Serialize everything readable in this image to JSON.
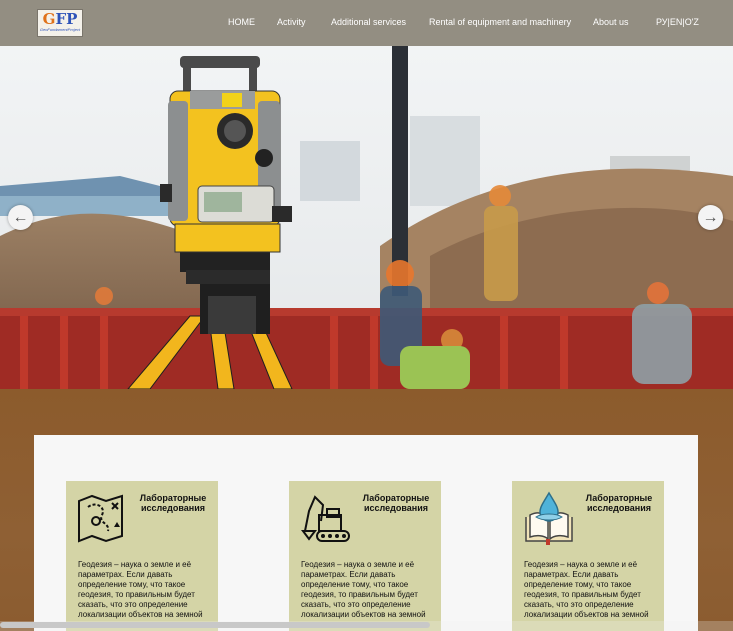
{
  "brand": {
    "logo_text": "GFP",
    "logo_subtext": "GeoFundamentProject"
  },
  "nav": {
    "items": [
      {
        "label": "HOME"
      },
      {
        "label": "Activity"
      },
      {
        "label": "Additional services"
      },
      {
        "label": "Rental of equipment and machinery"
      },
      {
        "label": "About us"
      }
    ],
    "lang": "РУ|EN|O'Z"
  },
  "hero": {
    "prev_icon": "arrow-left-icon",
    "next_icon": "arrow-right-icon"
  },
  "cards": [
    {
      "icon": "map-icon",
      "title": "Лабораторные исследования",
      "text": "Геодезия – наука о земле и её параметрах. Если давать определение тому, что такое геодезия, то правильным будет сказать, что это определение локализации объектов на земной"
    },
    {
      "icon": "excavator-icon",
      "title": "Лабораторные исследования",
      "text": "Геодезия – наука о земле и её параметрах. Если давать определение тому, что такое геодезия, то правильным будет сказать, что это определение локализации объектов на земной"
    },
    {
      "icon": "water-drop-book-icon",
      "title": "Лабораторные исследования",
      "text": "Геодезия – наука о земле и её параметрах. Если давать определение тому, что такое геодезия, то правильным будет сказать, что это определение локализации объектов на земной"
    }
  ],
  "colors": {
    "nav_bg": "#938e82",
    "band_bg": "#8c5b2c",
    "card_bg": "#d4d4a6",
    "panel_bg": "#f7f7f7"
  }
}
